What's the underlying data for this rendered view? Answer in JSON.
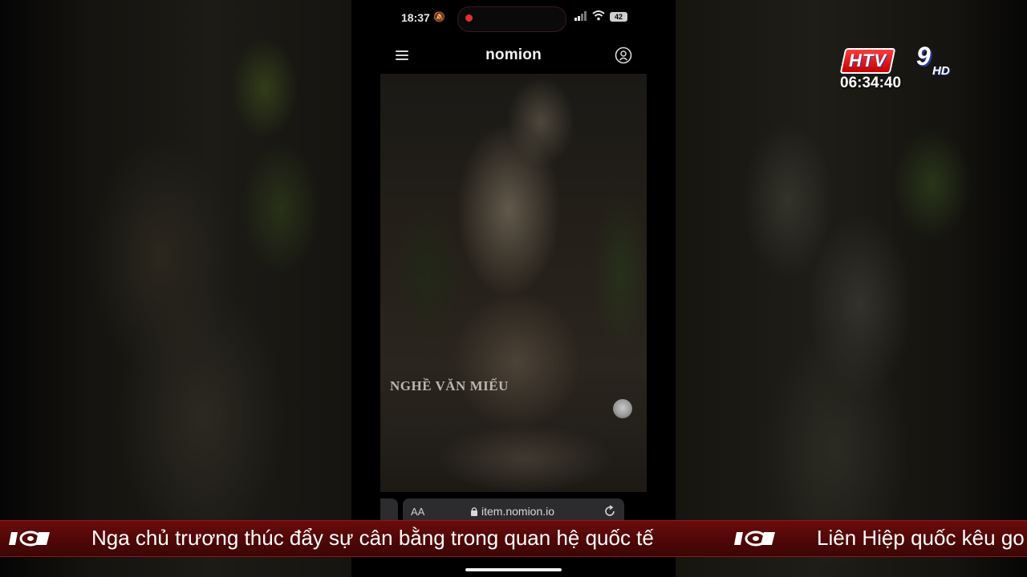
{
  "phone": {
    "status": {
      "time": "18:37",
      "battery": "42"
    },
    "header": {
      "brand": "nomion"
    },
    "hero": {
      "title": "NGHỀ VĂN MIẾU"
    },
    "browser": {
      "text_size": "AA",
      "url": "item.nomion.io"
    }
  },
  "broadcast": {
    "channel": {
      "name": "HTV",
      "number": "9",
      "quality": "HD"
    },
    "clock": "06:34:40",
    "ticker": {
      "headlines": [
        "Nga chủ trương thúc đẩy sự cân bằng trong quan hệ quốc tế",
        "Liên Hiệp quốc kêu go"
      ]
    }
  }
}
